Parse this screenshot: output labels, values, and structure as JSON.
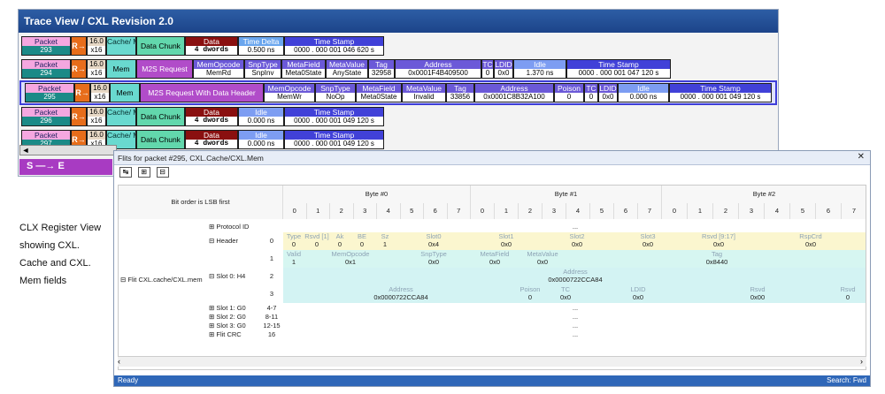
{
  "trace": {
    "title": "Trace View / CXL Revision 2.0",
    "packets": [
      {
        "label": "Packet",
        "num": "293",
        "gen": "16.0",
        "width": "x16",
        "type": "Cache/ Mem",
        "chunk": "Data Chunk",
        "data_h": "Data",
        "data_v": "4 dwords",
        "time_h": "Time Delta",
        "time_v": "0.500 ns",
        "ts_h": "Time Stamp",
        "ts_v": "0000 . 000 001 046 620 s"
      },
      {
        "label": "Packet",
        "num": "294",
        "gen": "16.0",
        "width": "x16",
        "type": "Mem",
        "msg": "M2S Request",
        "fields": [
          [
            "MemOpcode",
            "MemRd"
          ],
          [
            "SnpType",
            "SnpInv"
          ],
          [
            "MetaField",
            "Meta0State"
          ],
          [
            "MetaValue",
            "AnyState"
          ],
          [
            "Tag",
            "32958"
          ],
          [
            "Address",
            "0x0001F4B409500"
          ],
          [
            "TC",
            "0"
          ],
          [
            "LDID",
            "0x0"
          ]
        ],
        "idle_h": "Idle",
        "idle_v": "1.370 ns",
        "ts_h": "Time Stamp",
        "ts_v": "0000 . 000 001 047 120 s"
      },
      {
        "label": "Packet",
        "num": "295",
        "gen": "16.0",
        "width": "x16",
        "type": "Mem",
        "msg": "M2S Request With Data Header",
        "fields": [
          [
            "MemOpcode",
            "MemWr"
          ],
          [
            "SnpType",
            "NoOp"
          ],
          [
            "MetaField",
            "Meta0State"
          ],
          [
            "MetaValue",
            "Invalid"
          ],
          [
            "Tag",
            "33856"
          ],
          [
            "Address",
            "0x0001C8B32A100"
          ],
          [
            "Poison",
            "0"
          ],
          [
            "TC",
            "0"
          ],
          [
            "LDID",
            "0x0"
          ]
        ],
        "idle_h": "Idle",
        "idle_v": "0.000 ns",
        "ts_h": "Time Stamp",
        "ts_v": "0000 . 000 001 049 120 s"
      },
      {
        "label": "Packet",
        "num": "296",
        "gen": "16.0",
        "width": "x16",
        "type": "Cache/ Mem",
        "chunk": "Data Chunk",
        "data_h": "Data",
        "data_v": "4 dwords",
        "time_h": "Idle",
        "time_v": "0.000 ns",
        "ts_h": "Time Stamp",
        "ts_v": "0000 . 000 001 049 120 s"
      },
      {
        "label": "Packet",
        "num": "297",
        "gen": "16.0",
        "width": "x16",
        "type": "Cache/ Mem",
        "chunk": "Data Chunk",
        "data_h": "Data",
        "data_v": "4 dwords",
        "time_h": "Idle",
        "time_v": "0.000 ns",
        "ts_h": "Time Stamp",
        "ts_v": "0000 . 000 001 049 120 s"
      }
    ],
    "arrow": "R→",
    "scroll_left": "◄",
    "se_label": "S —→ E"
  },
  "caption": [
    "CLX Register View",
    "showing CXL.",
    "Cache and CXL.",
    "Mem fields"
  ],
  "flits": {
    "title": "Flits for packet #295, CXL.Cache/CXL.Mem",
    "close": "✕",
    "bit_order": "Bit order is LSB first",
    "bytes": [
      "Byte #0",
      "Byte #1",
      "Byte #2"
    ],
    "bits": [
      "0",
      "1",
      "2",
      "3",
      "4",
      "5",
      "6",
      "7"
    ],
    "group": "Flit CXL.cache/CXL.mem",
    "rows": {
      "protocol_id": "Protocol ID",
      "header": "Header",
      "slot0": "Slot 0: H4",
      "slot1": "Slot 1: G0",
      "slot2": "Slot 2: G0",
      "slot3": "Slot 3: G0",
      "crc": "Flit CRC",
      "idx": [
        "0",
        "1",
        "2",
        "3",
        "4-7",
        "8-11",
        "12-15",
        "16"
      ],
      "ellipsis": "..."
    },
    "header_fields": [
      [
        "Type",
        "0"
      ],
      [
        "Rsvd [1]",
        "0"
      ],
      [
        "Ak",
        "0"
      ],
      [
        "BE",
        "0"
      ],
      [
        "Sz",
        "1"
      ],
      [
        "Slot0",
        "0x4"
      ],
      [
        "Slot1",
        "0x0"
      ],
      [
        "Slot2",
        "0x0"
      ],
      [
        "Slot3",
        "0x0"
      ],
      [
        "Rsvd [9:17]",
        "0x0"
      ],
      [
        "RspCrd",
        "0x0"
      ]
    ],
    "row1_fields": [
      [
        "Valid",
        "1"
      ],
      [
        "MemOpcode",
        "0x1"
      ],
      [
        "SnpType",
        "0x0"
      ],
      [
        "MetaField",
        "0x0"
      ],
      [
        "MetaValue",
        "0x0"
      ],
      [
        "Tag",
        "0x8440"
      ]
    ],
    "row2_field": [
      "Address",
      "0x0000722CCA84"
    ],
    "row3_fields": [
      [
        "Address",
        "0x0000722CCA84"
      ],
      [
        "Poison",
        "0"
      ],
      [
        "TC",
        "0x0"
      ],
      [
        "LDID",
        "0x0"
      ],
      [
        "Rsvd",
        "0x00"
      ],
      [
        "Rsvd",
        "0"
      ]
    ],
    "status_left": "Ready",
    "status_right": "Search: Fwd"
  }
}
